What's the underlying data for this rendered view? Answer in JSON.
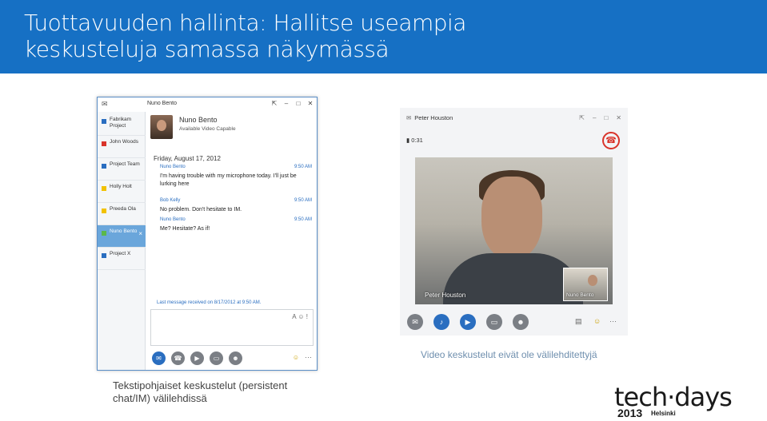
{
  "banner": {
    "title_line1": "Tuottavuuden hallinta: Hallitse useampia",
    "title_line2": "keskusteluja samassa näkymässä"
  },
  "im_window": {
    "title": "Nuno Bento",
    "tabs": [
      {
        "label": "Fabrikam Project",
        "color": "#2a6ec0"
      },
      {
        "label": "John Woods",
        "color": "#d9342b"
      },
      {
        "label": "Project Team",
        "color": "#2a6ec0"
      },
      {
        "label": "Holly Holt",
        "color": "#f2c200"
      },
      {
        "label": "Preeda Ola",
        "color": "#f2c200"
      },
      {
        "label": "Nuno Bento",
        "color": "#5bb84b",
        "close": "×"
      },
      {
        "label": "Project X",
        "color": "#2a6ec0"
      }
    ],
    "contact": {
      "name": "Nuno Bento",
      "status": "Available  Video Capable"
    },
    "conversation": {
      "date": "Friday, August 17, 2012",
      "messages": [
        {
          "sender": "Nuno Bento",
          "time": "9:50 AM",
          "text": "I'm having trouble with my microphone today. I'll just be lurking here"
        },
        {
          "sender": "Bob Kelly",
          "time": "9:50 AM",
          "text": "No problem. Don't hesitate to IM."
        },
        {
          "sender": "Nuno Bento",
          "time": "9:50 AM",
          "text": "Me? Hesitate? As if!"
        }
      ],
      "last_message": "Last message received on 8/17/2012 at 9:50 AM."
    },
    "input_tools": "A ☺ !",
    "more": "···"
  },
  "video_window": {
    "title": "Peter Houston",
    "timer": "0:31",
    "main_name": "Peter Houston",
    "pip_name": "Nuno Bento",
    "more": "···"
  },
  "captions": {
    "right": "Video keskustelut eivät ole välilehditettyjä",
    "left": "Tekstipohjaiset keskustelut (persistent chat/IM) välilehdissä"
  },
  "logo": {
    "main": "tech·days",
    "year": "2013",
    "city": "Helsinki"
  },
  "colors": {
    "banner": "#1670c4",
    "accent": "#2a6ec0",
    "hangup": "#d9342b"
  }
}
